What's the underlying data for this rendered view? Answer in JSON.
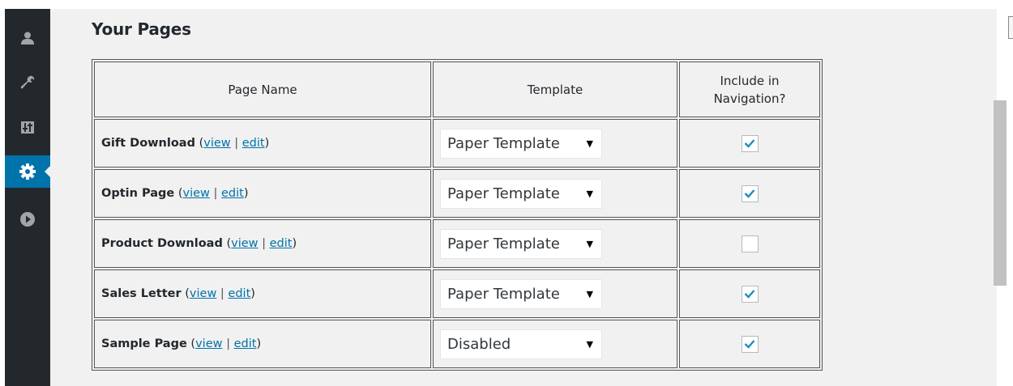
{
  "sidebar": {
    "items": [
      {
        "icon": "users-icon"
      },
      {
        "icon": "tools-icon"
      },
      {
        "icon": "settings-sliders-icon"
      },
      {
        "icon": "gear-icon",
        "active": true
      },
      {
        "icon": "play-icon"
      }
    ],
    "colors": {
      "background": "#23282d",
      "active": "#0073aa"
    }
  },
  "main": {
    "title": "Your Pages",
    "table": {
      "headers": {
        "page_name": "Page Name",
        "template": "Template",
        "nav_line1": "Include in",
        "nav_line2": "Navigation?"
      },
      "view_label": "view",
      "edit_label": "edit",
      "rows": [
        {
          "name": "Gift Download",
          "template": "Paper Template",
          "nav": true
        },
        {
          "name": "Optin Page",
          "template": "Paper Template",
          "nav": true
        },
        {
          "name": "Product Download",
          "template": "Paper Template",
          "nav": false
        },
        {
          "name": "Sales Letter",
          "template": "Paper Template",
          "nav": true
        },
        {
          "name": "Sample Page",
          "template": "Disabled",
          "nav": true
        }
      ]
    }
  },
  "colors": {
    "link": "#0073aa",
    "check": "#1e8cbe",
    "content_bg": "#f1f1f1"
  }
}
